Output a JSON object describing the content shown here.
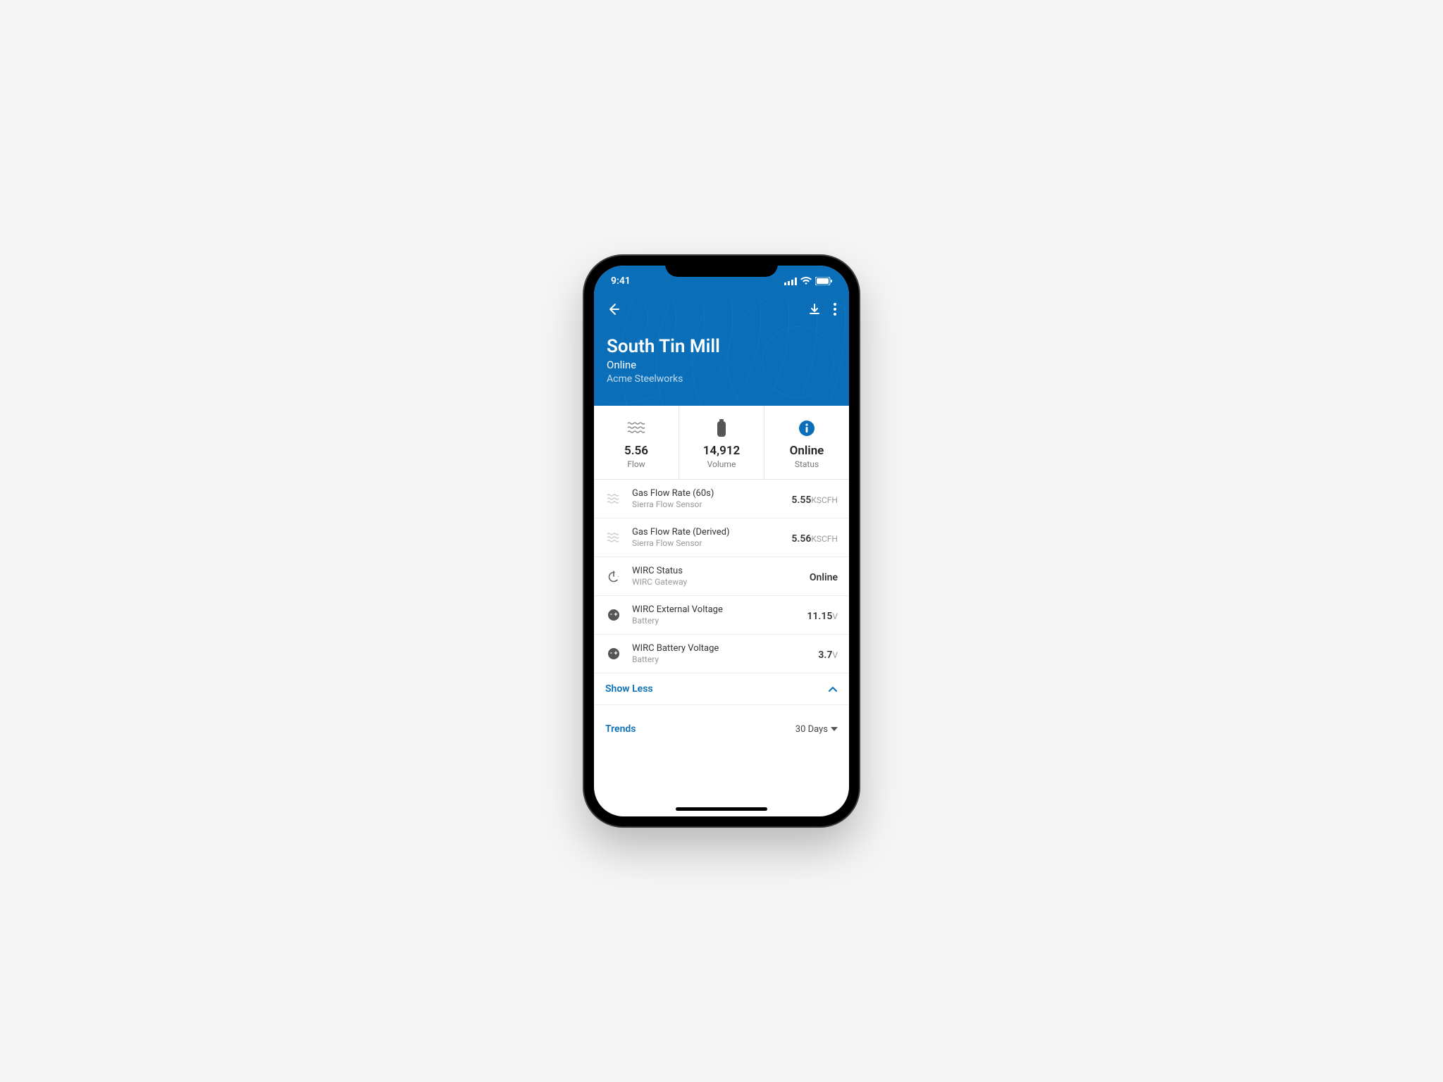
{
  "status_bar": {
    "time": "9:41"
  },
  "header": {
    "title": "South Tin Mill",
    "status": "Online",
    "org": "Acme Steelworks"
  },
  "cards": {
    "flow": {
      "value": "5.56",
      "label": "Flow"
    },
    "volume": {
      "value": "14,912",
      "label": "Volume"
    },
    "status": {
      "value": "Online",
      "label": "Status"
    }
  },
  "sensors": [
    {
      "icon": "wave",
      "title": "Gas Flow Rate (60s)",
      "sub": "Sierra Flow Sensor",
      "value": "5.55",
      "unit": "KSCFH"
    },
    {
      "icon": "wave",
      "title": "Gas Flow Rate (Derived)",
      "sub": "Sierra Flow Sensor",
      "value": "5.56",
      "unit": "KSCFH"
    },
    {
      "icon": "power",
      "title": "WIRC Status",
      "sub": "WIRC Gateway",
      "value": "Online",
      "unit": ""
    },
    {
      "icon": "battery",
      "title": "WIRC External Voltage",
      "sub": "Battery",
      "value": "11.15",
      "unit": "V"
    },
    {
      "icon": "battery",
      "title": "WIRC Battery Voltage",
      "sub": "Battery",
      "value": "3.7",
      "unit": "V"
    }
  ],
  "toggle": {
    "label": "Show Less"
  },
  "trends": {
    "label": "Trends",
    "range": "30 Days"
  }
}
